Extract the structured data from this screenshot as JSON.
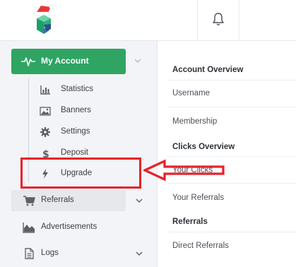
{
  "header": {
    "logo_icon": "cube-logo-with-santa-hat",
    "bell_icon": "bell-icon"
  },
  "sidebar": {
    "my_account": {
      "label": "My Account",
      "icon": "pulse-icon",
      "color": "#2fa463"
    },
    "subitems": [
      {
        "label": "Statistics",
        "icon": "bar-chart-icon"
      },
      {
        "label": "Banners",
        "icon": "image-icon"
      },
      {
        "label": "Settings",
        "icon": "gear-icon"
      },
      {
        "label": "Deposit",
        "icon": "dollar-icon"
      },
      {
        "label": "Upgrade",
        "icon": "lightning-icon"
      }
    ],
    "items": [
      {
        "label": "Referrals",
        "icon": "cart-icon"
      },
      {
        "label": "Advertisements",
        "icon": "area-chart-icon"
      },
      {
        "label": "Logs",
        "icon": "document-icon"
      }
    ]
  },
  "main": {
    "sections": [
      {
        "heading": "Account Overview",
        "rows": [
          "Username",
          "Membership"
        ]
      },
      {
        "heading": "Clicks Overview",
        "rows": [
          "Your Clicks",
          "Your Referrals"
        ]
      },
      {
        "heading": "Referrals",
        "rows": [
          "Direct Referrals"
        ]
      }
    ]
  },
  "annotation": {
    "color": "#e8202a"
  }
}
